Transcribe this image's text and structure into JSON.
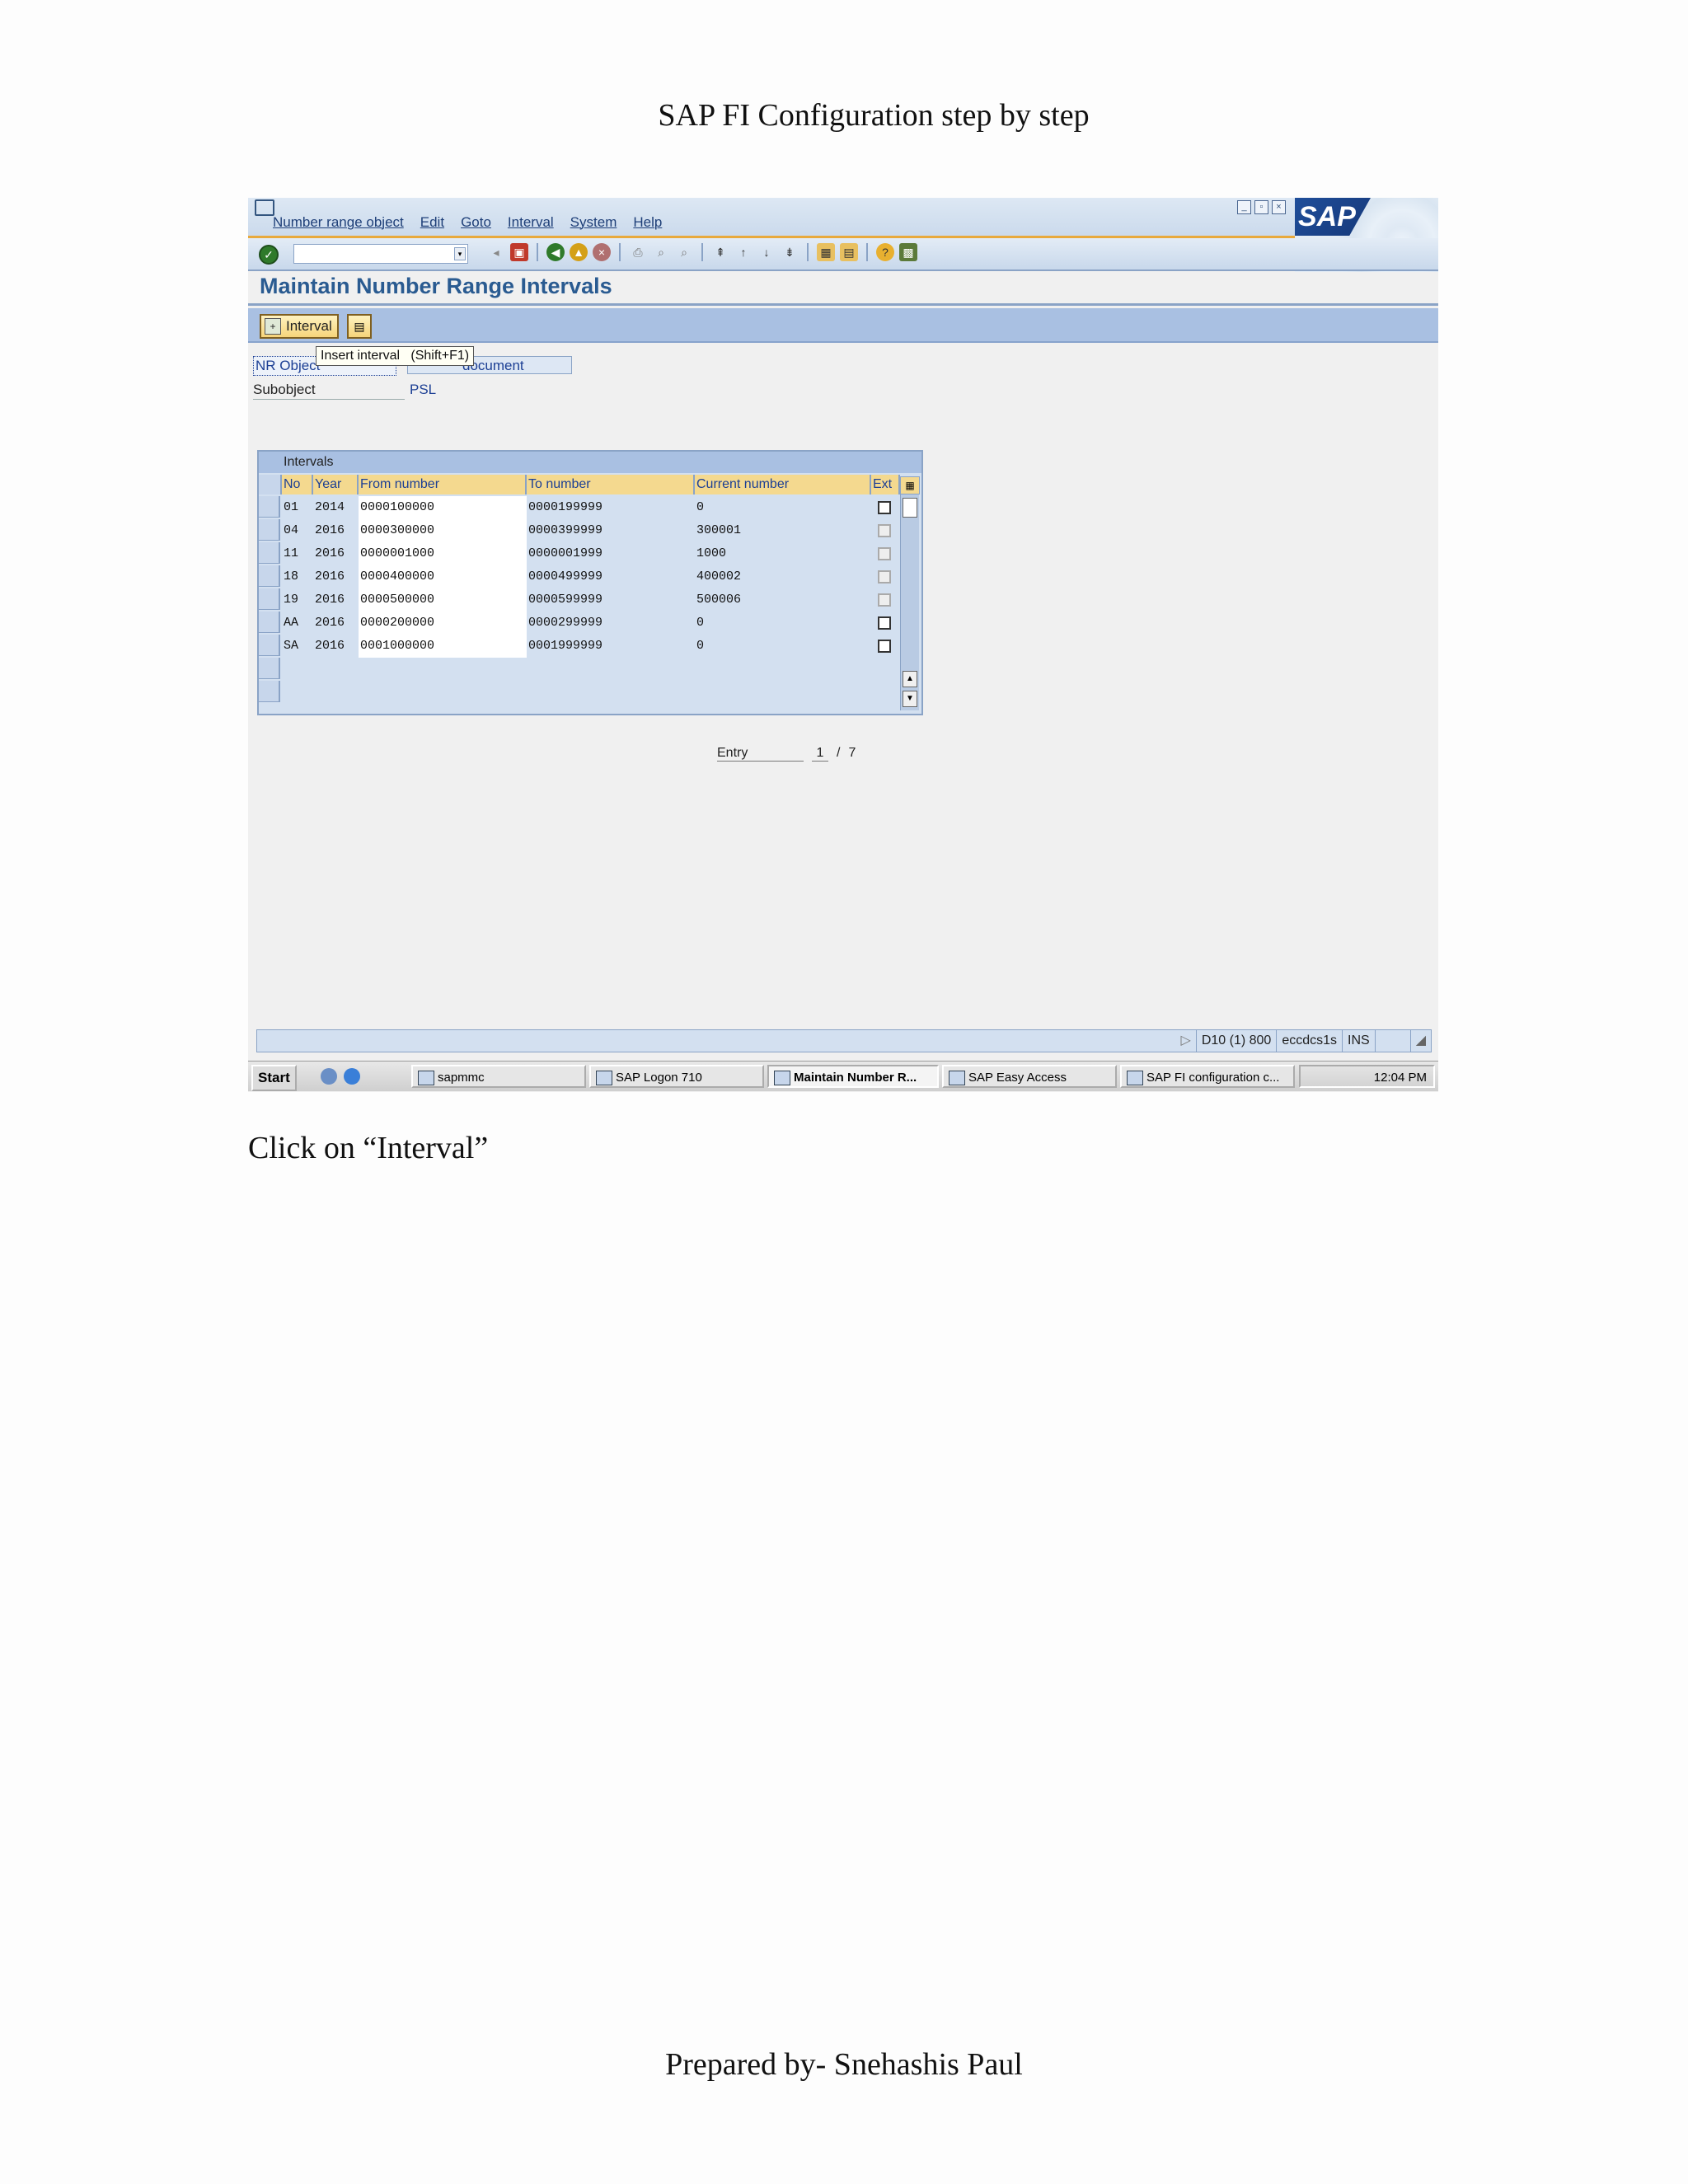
{
  "document": {
    "header": "SAP FI Configuration step by step",
    "caption": "Click on “Interval”",
    "footer": "Prepared by- Snehashis Paul"
  },
  "sap": {
    "menu": [
      "Number range object",
      "Edit",
      "Goto",
      "Interval",
      "System",
      "Help"
    ],
    "logo": "SAP",
    "screen_title": "Maintain Number Range Intervals",
    "app_toolbar": {
      "interval_button": "Interval"
    },
    "tooltip": "Insert interval   (Shift+F1)",
    "fields": {
      "nr_object_label": "NR Object",
      "nr_object_value": "document",
      "subobject_label": "Subobject",
      "subobject_value": "PSL"
    },
    "table": {
      "title": "Intervals",
      "columns": [
        "No",
        "Year",
        "From number",
        "To number",
        "Current number",
        "Ext"
      ],
      "rows": [
        {
          "no": "01",
          "year": "2014",
          "from": "0000100000",
          "to": "0000199999",
          "current": "0",
          "ext_enabled": true
        },
        {
          "no": "04",
          "year": "2016",
          "from": "0000300000",
          "to": "0000399999",
          "current": "300001",
          "ext_enabled": false
        },
        {
          "no": "11",
          "year": "2016",
          "from": "0000001000",
          "to": "0000001999",
          "current": "1000",
          "ext_enabled": false
        },
        {
          "no": "18",
          "year": "2016",
          "from": "0000400000",
          "to": "0000499999",
          "current": "400002",
          "ext_enabled": false
        },
        {
          "no": "19",
          "year": "2016",
          "from": "0000500000",
          "to": "0000599999",
          "current": "500006",
          "ext_enabled": false
        },
        {
          "no": "AA",
          "year": "2016",
          "from": "0000200000",
          "to": "0000299999",
          "current": "0",
          "ext_enabled": true
        },
        {
          "no": "SA",
          "year": "2016",
          "from": "0001000000",
          "to": "0001999999",
          "current": "0",
          "ext_enabled": true
        }
      ]
    },
    "entry": {
      "label": "Entry",
      "current": "1",
      "total": "7"
    },
    "status": {
      "system": "D10 (1) 800",
      "server": "eccdcs1s",
      "mode": "INS"
    },
    "taskbar": {
      "start": "Start",
      "tasks": [
        "sapmmc",
        "SAP Logon 710",
        "Maintain Number R...",
        "SAP Easy Access",
        "SAP FI configuration c..."
      ],
      "active_index": 2,
      "clock": "12:04 PM"
    }
  }
}
